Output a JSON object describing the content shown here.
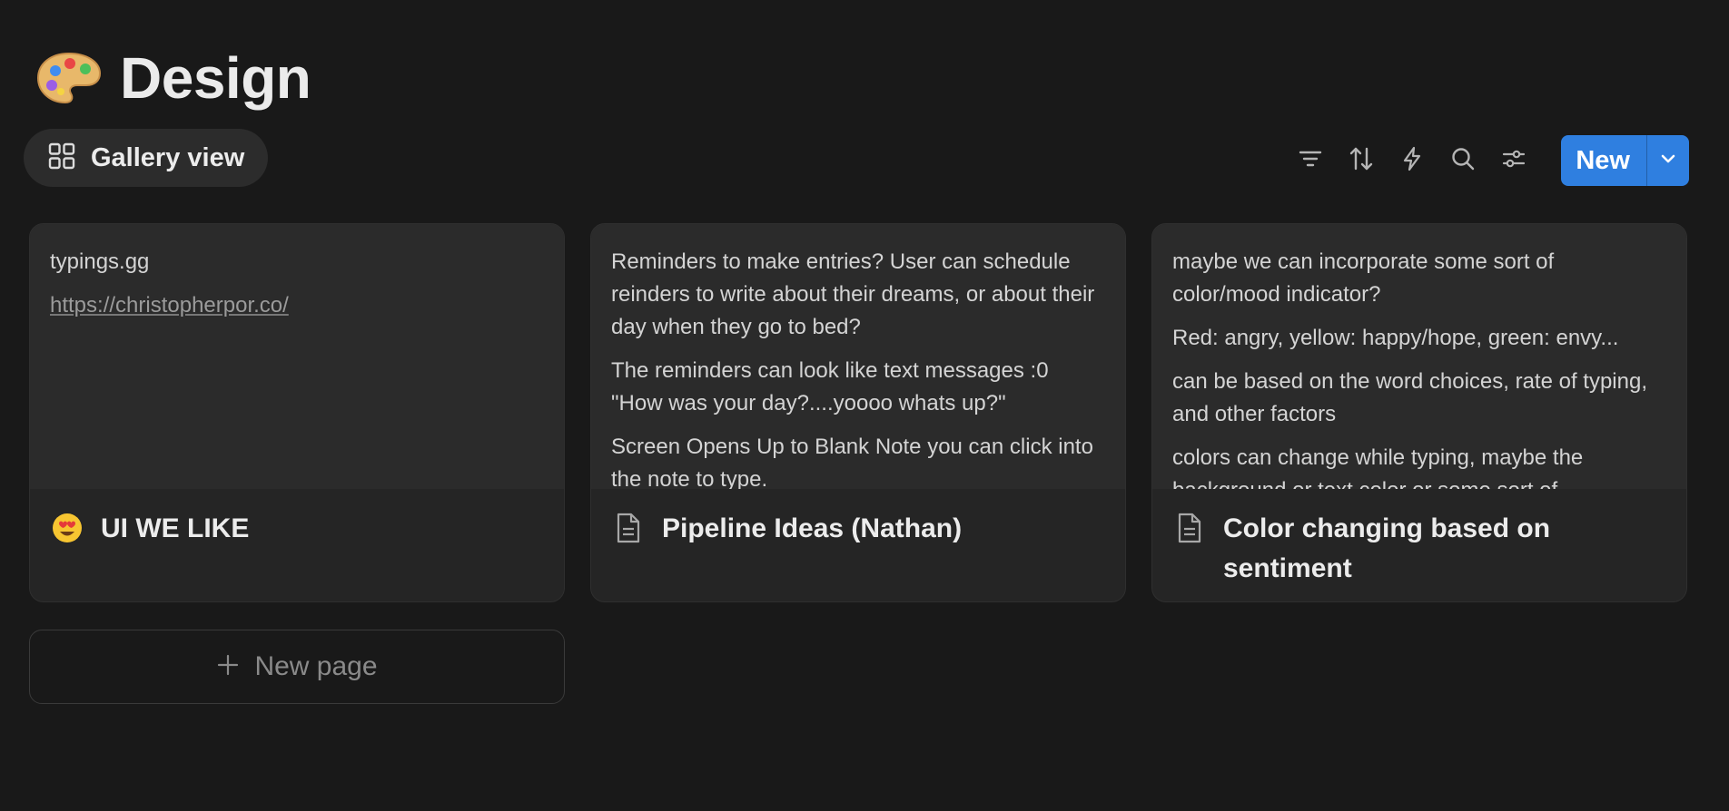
{
  "header": {
    "emoji": "🎨",
    "title": "Design"
  },
  "view_tab": {
    "icon": "gallery-grid-icon",
    "label": "Gallery view"
  },
  "toolbar": {
    "icons": [
      "filter-icon",
      "sort-icon",
      "lightning-icon",
      "search-icon",
      "settings-sliders-icon"
    ],
    "new_label": "New",
    "new_dropdown_icon": "chevron-down-icon",
    "accent": "#2f7fe0"
  },
  "cards": [
    {
      "preview": [
        "typings.gg",
        "https://christopherpor.co/"
      ],
      "icon": "😍",
      "title": "UI WE LIKE"
    },
    {
      "preview": [
        "Reminders to make entries? User can schedule reinders to write about their dreams, or about their day when they go to bed?",
        "The reminders can look like text messages :0 \"How was your day?....yoooo whats up?\"",
        "Screen Opens Up to Blank Note you can click into the note to type."
      ],
      "icon": "document-icon",
      "title": "Pipeline Ideas (Nathan)"
    },
    {
      "preview": [
        "maybe we can incorporate some sort of color/mood indicator?",
        "Red: angry, yellow: happy/hope, green: envy...",
        "can be based on the word choices, rate of typing, and other factors",
        "colors can change while typing, maybe the background or text color or some sort of"
      ],
      "icon": "document-icon",
      "title": "Color changing based on sentiment"
    }
  ],
  "new_page": {
    "icon": "plus-icon",
    "label": "New page"
  }
}
